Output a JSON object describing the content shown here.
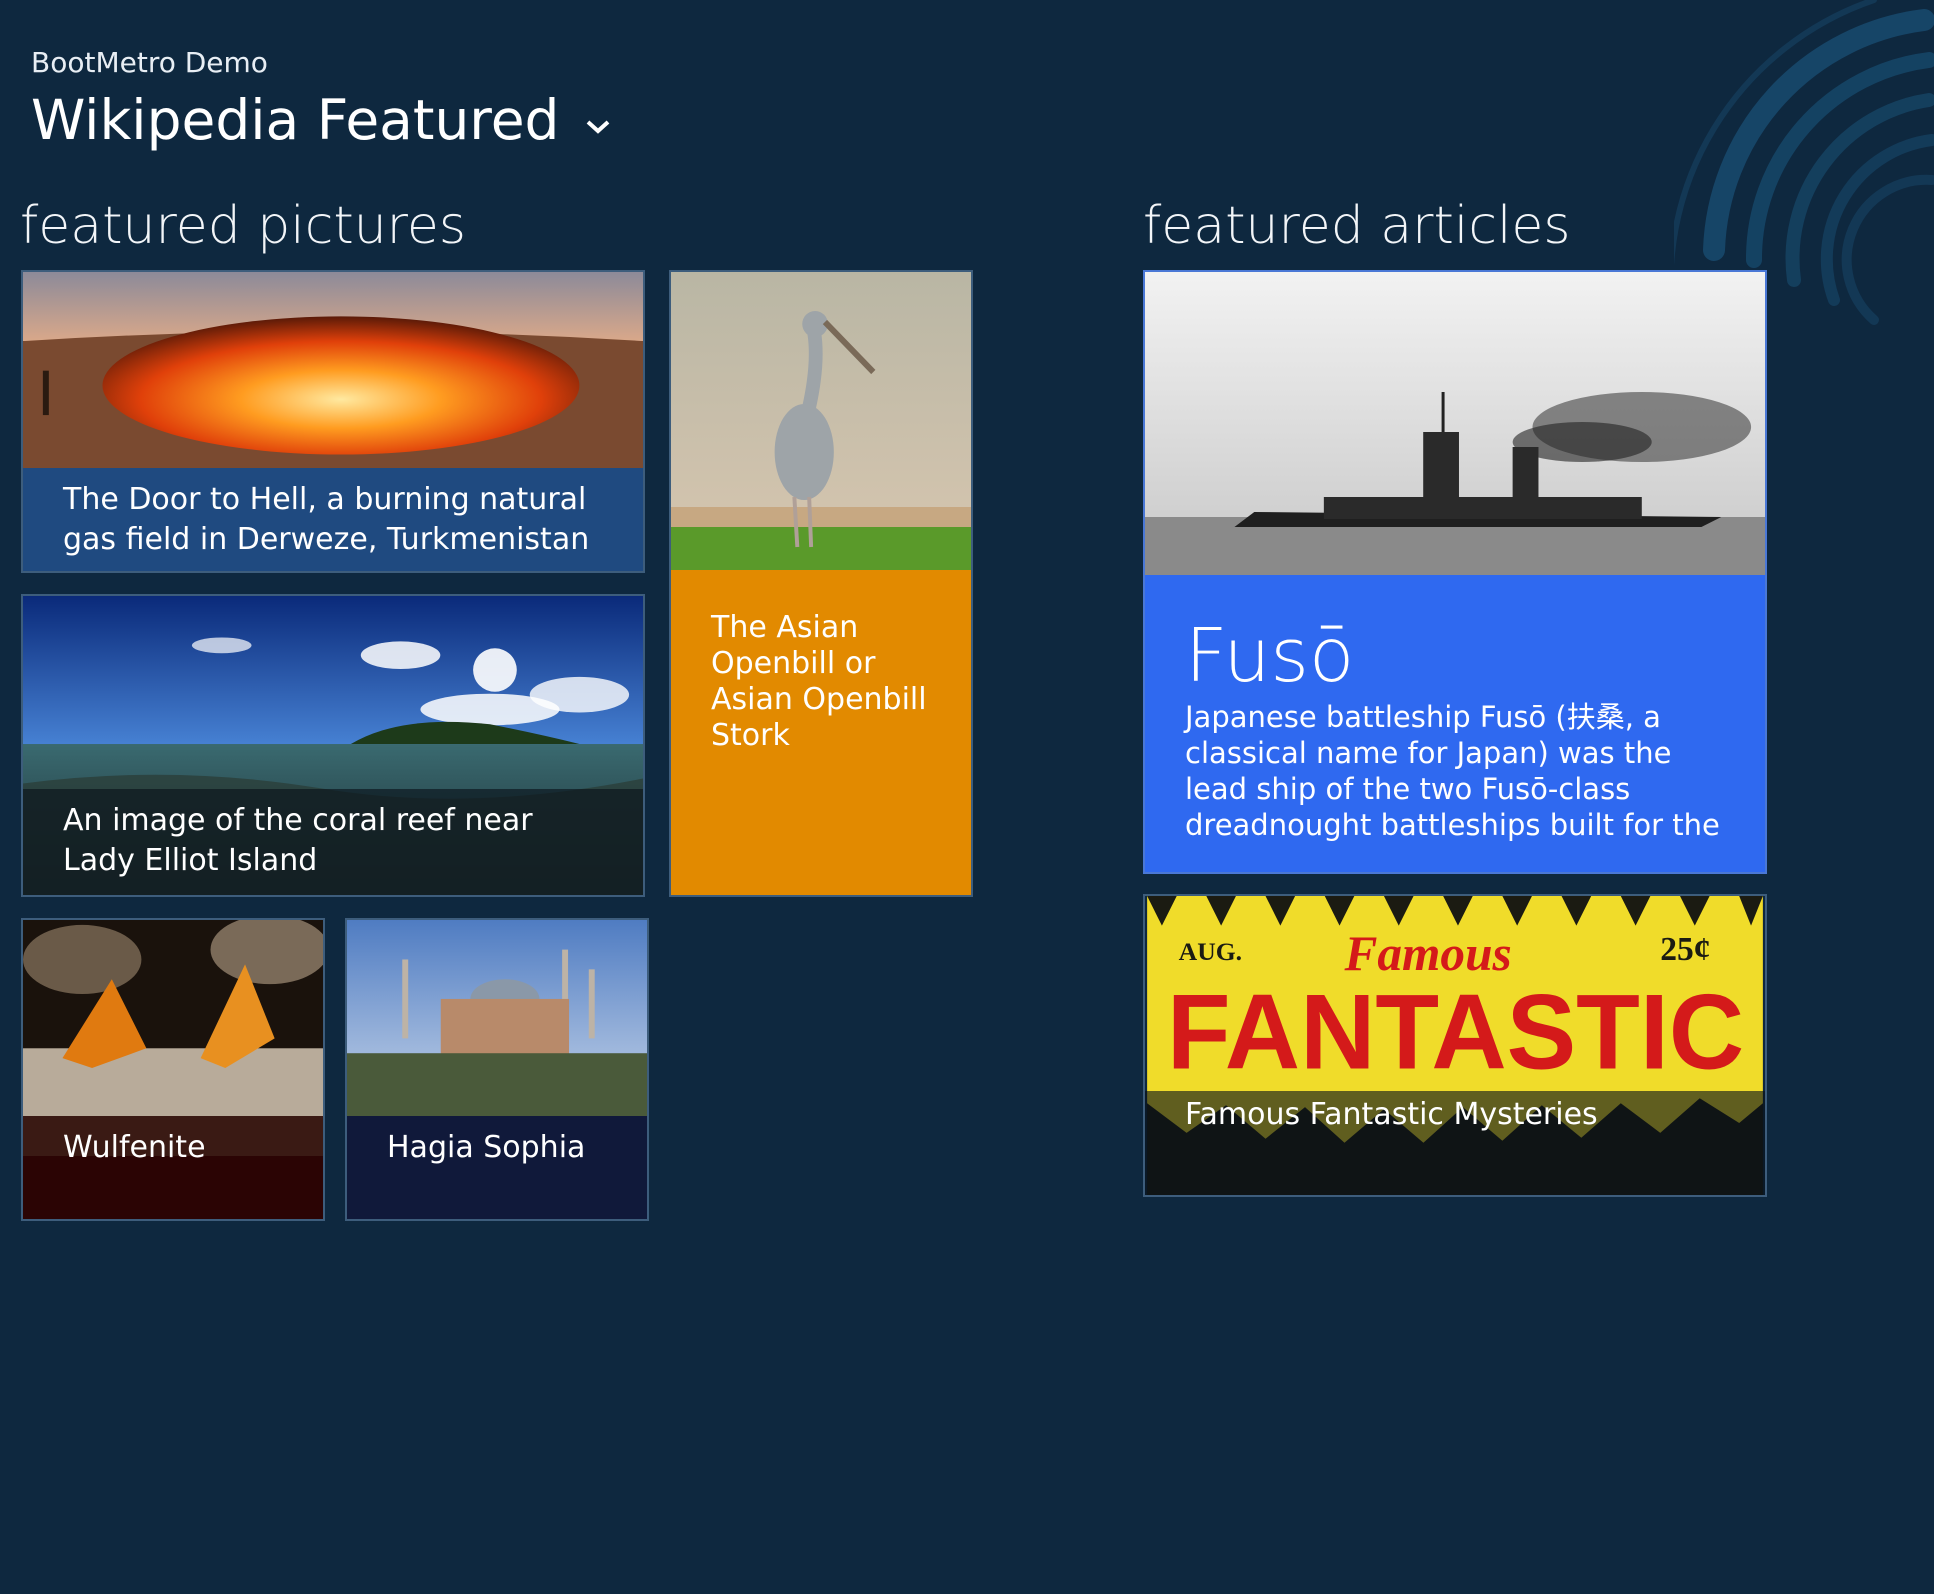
{
  "header": {
    "app_title": "BootMetro Demo",
    "hub_title": "Wikipedia Featured",
    "hub_chevron_icon": "chevron-down-icon"
  },
  "sections": {
    "pictures": {
      "title": "featured pictures",
      "tiles": [
        {
          "caption": "The Door to Hell, a burning natural gas field in Derweze, Turkmenistan"
        },
        {
          "caption": "An image of the coral reef near Lady Elliot Island"
        },
        {
          "caption": "The Asian Openbill or Asian Openbill Stork"
        },
        {
          "caption": "Wulfenite"
        },
        {
          "caption": "Hagia Sophia"
        }
      ]
    },
    "articles": {
      "title": "featured articles",
      "tiles": [
        {
          "title": "Fusō",
          "description": "Japanese battleship Fusō (扶桑, a classical name for Japan) was the lead ship of the two Fusō-class dreadnought battleships built for the"
        },
        {
          "caption": "Famous Fantastic Mysteries",
          "cover_month": "AUG.",
          "cover_price": "25¢",
          "cover_word_top": "Famous",
          "cover_word_main": "FANTASTIC"
        }
      ]
    }
  },
  "colors": {
    "background": "#0e283f",
    "tile_blue": "#2f69f0",
    "tile_orange": "#e28a00",
    "caption_blue": "#1f4a80"
  }
}
